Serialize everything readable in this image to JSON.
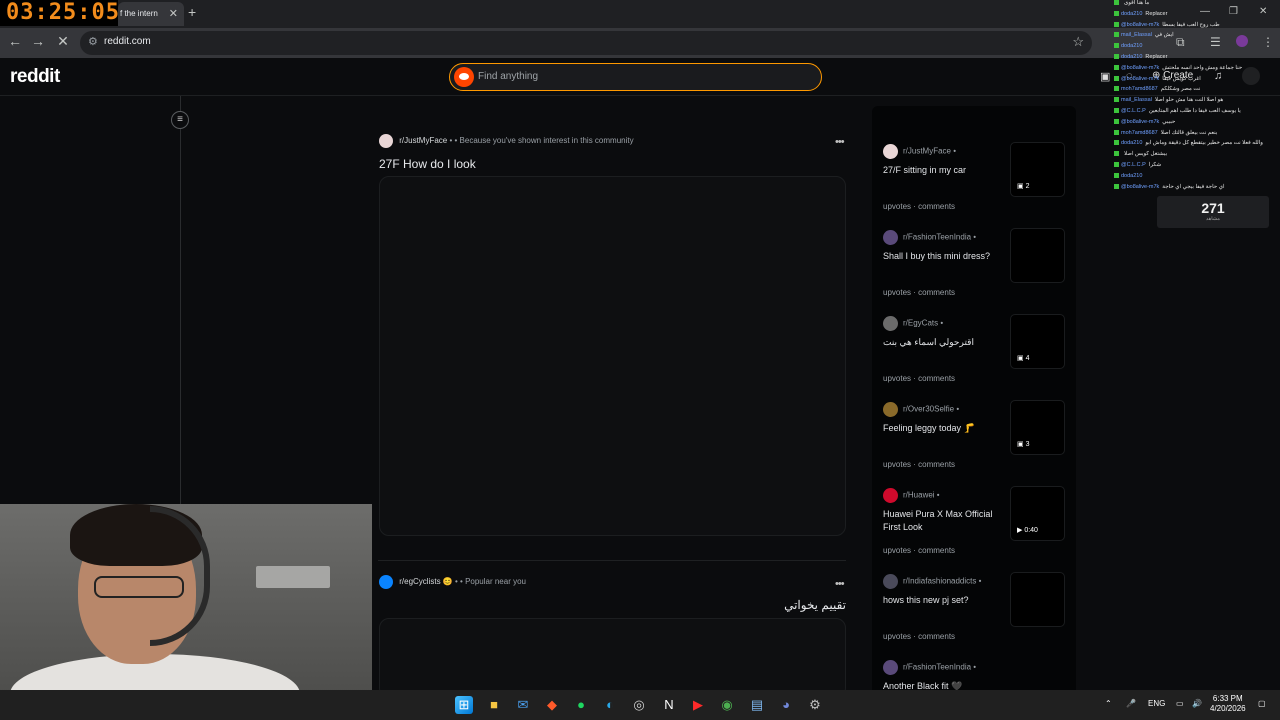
{
  "stream_timer": "03:25:05",
  "browser": {
    "tab_title": "f the intern",
    "url": "reddit.com"
  },
  "reddit": {
    "logo": "reddit",
    "search_placeholder": "Find anything",
    "create_label": "Create"
  },
  "feed": {
    "posts": [
      {
        "subreddit": "r/JustMyFace",
        "reason": "Because you've shown interest in this community",
        "title": "27F How do I look",
        "avatar_color": "#e9d6d6"
      },
      {
        "subreddit": "r/egCyclists",
        "reason": "Popular near you",
        "title": "تقييم يخواتي",
        "avatar_color": "#0a84ff",
        "emoji": "😊"
      }
    ]
  },
  "recent": [
    {
      "subreddit": "r/JustMyFace",
      "title": "27/F sitting in my car",
      "badge": "2",
      "badge_icon": "gallery-icon",
      "upvotes": "upvotes",
      "comments": "comments",
      "avatar_color": "#e9d6d6"
    },
    {
      "subreddit": "r/FashionTeenIndia",
      "title": "Shall I buy this mini dress?",
      "badge": "",
      "badge_icon": "",
      "upvotes": "upvotes",
      "comments": "comments",
      "avatar_color": "#5a4a7a"
    },
    {
      "subreddit": "r/EgyCats",
      "title": "اقترحولي اسماء هي بنت",
      "badge": "4",
      "badge_icon": "gallery-icon",
      "upvotes": "upvotes",
      "comments": "comments",
      "avatar_color": "#6b6b6b"
    },
    {
      "subreddit": "r/Over30Selfie",
      "title": "Feeling leggy today 🦵",
      "badge": "3",
      "badge_icon": "gallery-icon",
      "upvotes": "upvotes",
      "comments": "comments",
      "avatar_color": "#8a6a2a"
    },
    {
      "subreddit": "r/Huawei",
      "title": "Huawei Pura X Max Official First Look",
      "badge": "0:40",
      "badge_icon": "play-icon",
      "upvotes": "upvotes",
      "comments": "comments",
      "avatar_color": "#cf0a2c"
    },
    {
      "subreddit": "r/Indiafashionaddicts",
      "title": "hows this new pj set?",
      "badge": "",
      "badge_icon": "",
      "upvotes": "upvotes",
      "comments": "comments",
      "avatar_color": "#4a4a5a"
    },
    {
      "subreddit": "r/FashionTeenIndia",
      "title": "Another Black fit 🖤",
      "badge": "",
      "badge_icon": "",
      "upvotes": "",
      "comments": "",
      "avatar_color": "#5a4a7a"
    }
  ],
  "chat": {
    "lines": [
      {
        "user": "",
        "msg": "ما هنا اقوى"
      },
      {
        "user": "doda210",
        "msg": "Replacer"
      },
      {
        "user": "@bo8alive-m7k",
        "msg": "طب روح العب فيفا بسطا"
      },
      {
        "user": "mail_Elassal",
        "msg": "ايش في"
      },
      {
        "user": "doda210",
        "msg": ""
      },
      {
        "user": "doda210",
        "msg": "Replacer"
      },
      {
        "user": "@bo8alive-m7k",
        "msg": "حنا جماعة ومش واحد انسه ملحتش"
      },
      {
        "user": "@bo8alive-m7k",
        "msg": "اغرب كويس فيفا"
      },
      {
        "user": "moh7amd8687",
        "msg": "نت مصر وشكلكم"
      },
      {
        "user": "mail_Elassal",
        "msg": "هو اصلا النت هنا مش حلو اصلا"
      },
      {
        "user": "@C.L.C.P",
        "msg": "يا يوسف العب فيفا دا طلب اهم المتابعين"
      },
      {
        "user": "@bo8alive-m7k",
        "msg": "حبيبي"
      },
      {
        "user": "moh7amd8687",
        "msg": "بنعم نت بيعلق قالتك اصلا"
      },
      {
        "user": "doda210",
        "msg": "والله فعلا نت مصر خطير بيتقطع كل دقيقة وماش ابو"
      },
      {
        "user": "",
        "msg": "بيشتغل كويس اصلا"
      },
      {
        "user": "@C.L.C.P",
        "msg": "شكرا"
      },
      {
        "user": "doda210",
        "msg": ""
      },
      {
        "user": "@bo8alive-m7k",
        "msg": "اي حاجة فيفا بيجي اي حاجة"
      }
    ],
    "viewers": "271",
    "viewers_label": "مشاهد"
  },
  "taskbar": {
    "lang": "ENG",
    "time": "6:33 PM",
    "date": "4/20/2026"
  }
}
